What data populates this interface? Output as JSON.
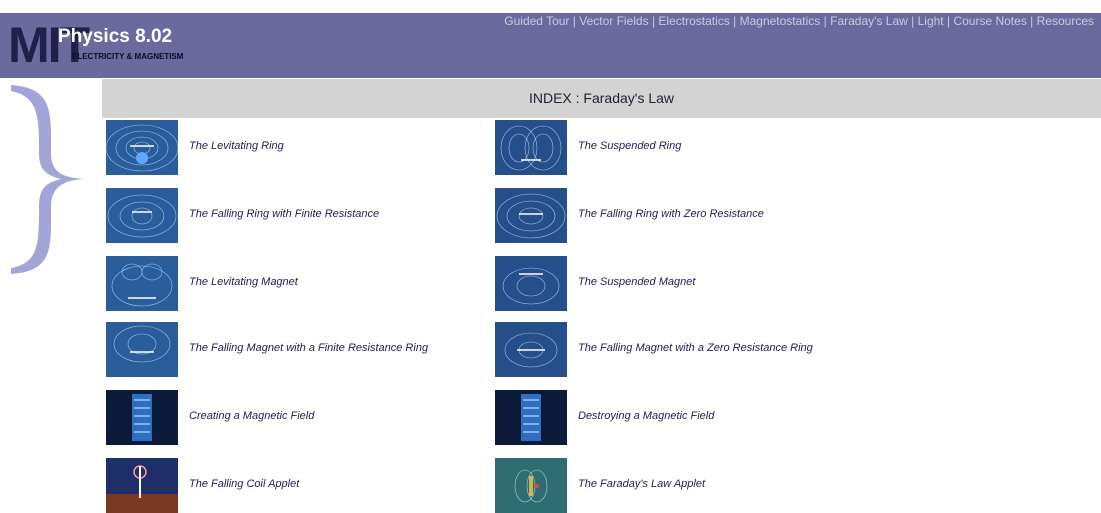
{
  "header": {
    "logo_mit": "MIT",
    "logo_title": "Physics 8.02",
    "logo_subtitle": "ELECTRICITY & MAGNETISM",
    "nav": [
      "Guided Tour",
      "Vector Fields",
      "Electrostatics",
      "Magnetostatics",
      "Faraday's Law",
      "Light",
      "Course Notes",
      "Resources"
    ],
    "nav_separator": "|",
    "background_color": "#6b6a9e"
  },
  "index_bar": {
    "title": "INDEX : Faraday's Law",
    "background_color": "#d3d3d3"
  },
  "items": [
    {
      "label": "The Levitating Ring",
      "icon": "field-lines-ring-thumbnail"
    },
    {
      "label": "The Suspended Ring",
      "icon": "field-lines-ring-thumbnail"
    },
    {
      "label": "The Falling Ring with Finite Resistance",
      "icon": "field-lines-ring-thumbnail"
    },
    {
      "label": "The Falling Ring with Zero Resistance",
      "icon": "field-lines-ring-thumbnail"
    },
    {
      "label": "The Levitating Magnet",
      "icon": "field-lines-magnet-thumbnail"
    },
    {
      "label": "The Suspended Magnet",
      "icon": "field-lines-magnet-thumbnail"
    },
    {
      "label": "The Falling Magnet with a Finite Resistance Ring",
      "icon": "field-lines-magnet-thumbnail"
    },
    {
      "label": "The Falling Magnet with a Zero Resistance Ring",
      "icon": "field-lines-magnet-thumbnail"
    },
    {
      "label": "Creating a Magnetic Field",
      "icon": "solenoid-thumbnail"
    },
    {
      "label": "Destroying a Magnetic Field",
      "icon": "solenoid-thumbnail"
    },
    {
      "label": "The Falling Coil Applet",
      "icon": "coil-applet-thumbnail"
    },
    {
      "label": "The Faraday's Law Applet",
      "icon": "faraday-applet-thumbnail"
    }
  ]
}
